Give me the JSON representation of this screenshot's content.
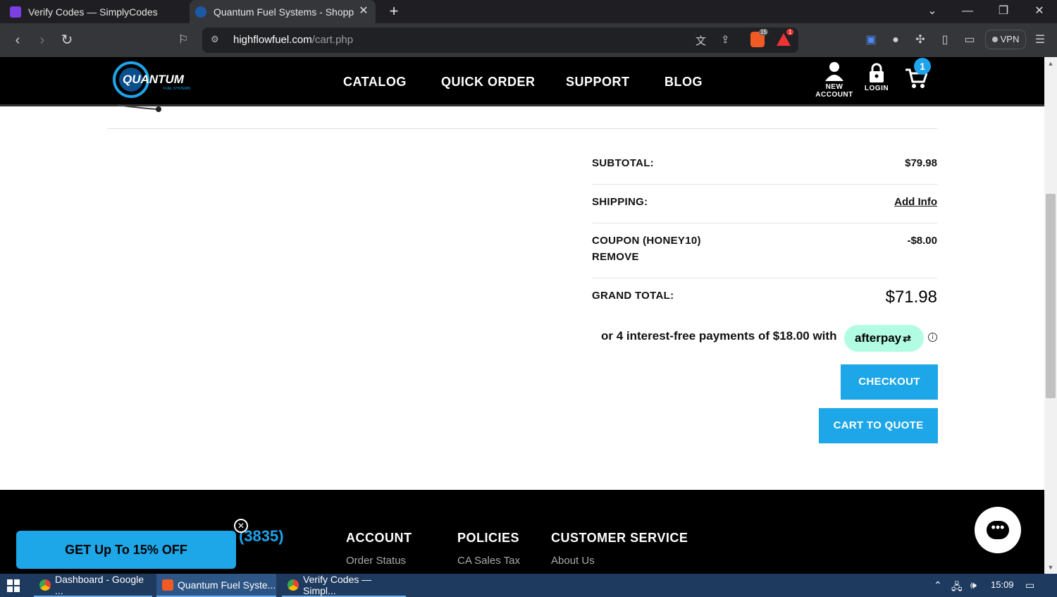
{
  "browser": {
    "tabs": [
      {
        "title": "Verify Codes — SimplyCodes",
        "active": false
      },
      {
        "title": "Quantum Fuel Systems - Shopping",
        "active": true
      }
    ],
    "url_host": "highflowfuel.com",
    "url_path": "/cart.php",
    "shield_count": "15",
    "alert_count": "1",
    "vpn_label": "VPN"
  },
  "header": {
    "logo_text": "QUANTUM",
    "logo_sub": "FUEL SYSTEMS",
    "nav": [
      "CATALOG",
      "QUICK ORDER",
      "SUPPORT",
      "BLOG"
    ],
    "new_account_line1": "NEW",
    "new_account_line2": "ACCOUNT",
    "login_label": "LOGIN",
    "cart_count": "1"
  },
  "summary": {
    "subtotal_label": "SUBTOTAL:",
    "subtotal_value": "$79.98",
    "shipping_label": "SHIPPING:",
    "shipping_value": "Add Info",
    "coupon_label": "COUPON (HONEY10)",
    "coupon_remove": "REMOVE",
    "coupon_value": "-$8.00",
    "grand_label": "GRAND TOTAL:",
    "grand_value": "$71.98",
    "afterpay_text": "or 4 interest-free payments of $18.00 with",
    "afterpay_brand": "afterpay",
    "checkout": "CHECKOUT",
    "cart_to_quote": "CART TO QUOTE"
  },
  "footer": {
    "phone_fragment": "(3835)",
    "headings": [
      "ACCOUNT",
      "POLICIES",
      "CUSTOMER SERVICE"
    ],
    "links": [
      "Order Status",
      "CA Sales Tax",
      "About Us"
    ],
    "promo": "GET Up To 15% OFF"
  },
  "taskbar": {
    "items": [
      "Dashboard - Google ...",
      "Quantum Fuel Syste...",
      "Verify Codes — Simpl..."
    ],
    "time": "15:09"
  },
  "colors": {
    "accent": "#1ea7e8",
    "afterpay": "#b2fce4",
    "header_bg": "#000000"
  }
}
